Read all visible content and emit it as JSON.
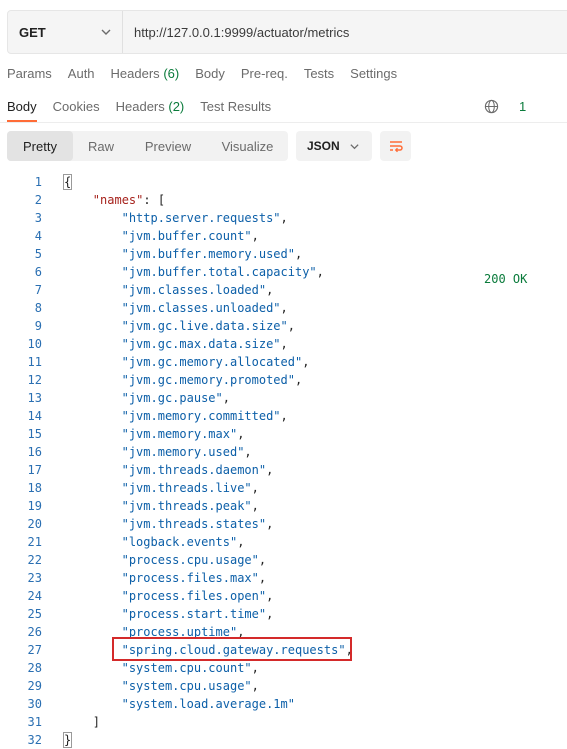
{
  "request": {
    "method": "GET",
    "url": "http://127.0.0.1:9999/actuator/metrics"
  },
  "request_tabs": [
    {
      "label": "Params"
    },
    {
      "label": "Auth"
    },
    {
      "label": "Headers",
      "count": "(6)"
    },
    {
      "label": "Body"
    },
    {
      "label": "Pre-req."
    },
    {
      "label": "Tests"
    },
    {
      "label": "Settings"
    }
  ],
  "response_tabs": [
    {
      "label": "Body",
      "active": true
    },
    {
      "label": "Cookies"
    },
    {
      "label": "Headers",
      "count": "(2)"
    },
    {
      "label": "Test Results"
    }
  ],
  "status": {
    "code": "200 OK",
    "more": "1"
  },
  "view_modes": [
    "Pretty",
    "Raw",
    "Preview",
    "Visualize"
  ],
  "active_view_mode": "Pretty",
  "format": "JSON",
  "colors": {
    "accent": "#ff6c37",
    "status_ok": "#0a7b3b",
    "highlight_box": "#d42a2a"
  },
  "json_body": {
    "key": "\"names\"",
    "values": [
      "http.server.requests",
      "jvm.buffer.count",
      "jvm.buffer.memory.used",
      "jvm.buffer.total.capacity",
      "jvm.classes.loaded",
      "jvm.classes.unloaded",
      "jvm.gc.live.data.size",
      "jvm.gc.max.data.size",
      "jvm.gc.memory.allocated",
      "jvm.gc.memory.promoted",
      "jvm.gc.pause",
      "jvm.memory.committed",
      "jvm.memory.max",
      "jvm.memory.used",
      "jvm.threads.daemon",
      "jvm.threads.live",
      "jvm.threads.peak",
      "jvm.threads.states",
      "logback.events",
      "process.cpu.usage",
      "process.files.max",
      "process.files.open",
      "process.start.time",
      "process.uptime",
      "spring.cloud.gateway.requests",
      "system.cpu.count",
      "system.cpu.usage",
      "system.load.average.1m"
    ],
    "highlighted_value": "spring.cloud.gateway.requests"
  }
}
